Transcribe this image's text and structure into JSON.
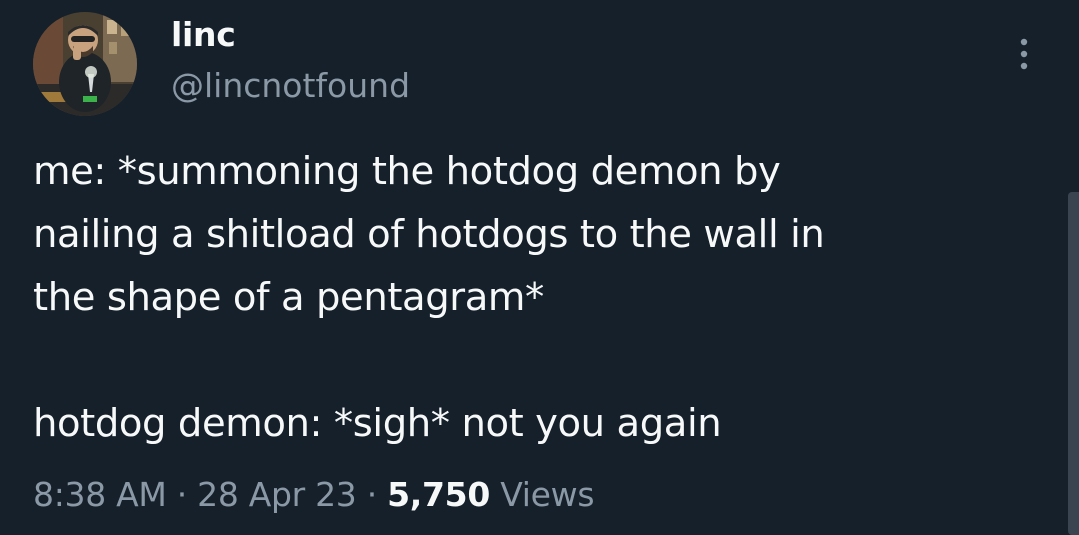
{
  "user": {
    "display_name": "linc",
    "handle": "@lincnotfound",
    "avatar_icon": "profile-photo"
  },
  "tweet": {
    "text_lines": [
      "me: *summoning the hotdog demon by",
      "nailing a shitload of hotdogs to the wall in",
      "the shape of a pentagram*",
      "",
      "hotdog demon: *sigh* not you again"
    ]
  },
  "meta": {
    "time": "8:38 AM",
    "separator": "·",
    "date": "28 Apr 23",
    "views_count": "5,750",
    "views_label": "Views"
  },
  "icons": {
    "more": "more-vertical-icon"
  },
  "colors": {
    "background": "#15202b",
    "primary_text": "#f7f9f9",
    "secondary_text": "#8b98a5"
  }
}
